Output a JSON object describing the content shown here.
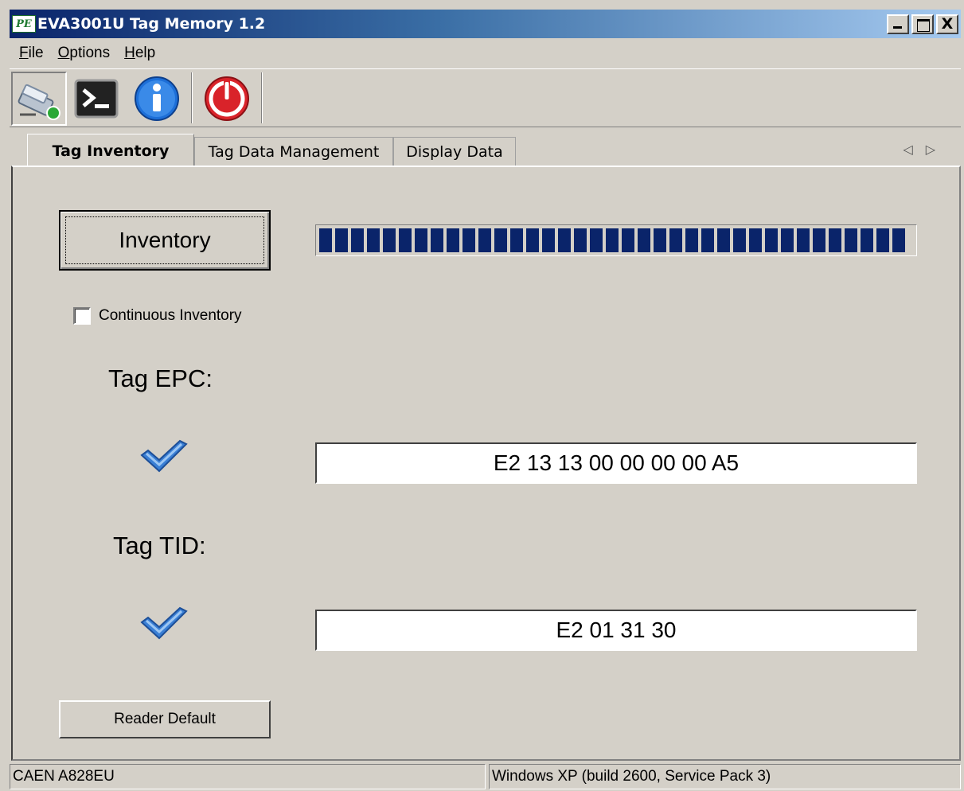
{
  "window": {
    "app_icon": "PE",
    "title": "EVA3001U Tag Memory 1.2",
    "close_glyph": "X"
  },
  "menu": {
    "file": "F",
    "file_rest": "ile",
    "options": "O",
    "options_rest": "ptions",
    "help": "H",
    "help_rest": "elp"
  },
  "toolbar": {
    "icons": [
      "usb-connected-icon",
      "terminal-icon",
      "info-icon",
      "power-icon"
    ]
  },
  "tabs": [
    {
      "label": "Tag Inventory",
      "active": true
    },
    {
      "label": "Tag Data Management",
      "active": false
    },
    {
      "label": "Display Data",
      "active": false
    }
  ],
  "tab_scroll": {
    "left": "◁",
    "right": "▷"
  },
  "inventory": {
    "button_label": "Inventory",
    "progress_fraction": 1.0,
    "continuous_label": "Continuous Inventory",
    "continuous_checked": false
  },
  "epc": {
    "label": "Tag EPC:",
    "value": "E2 13 13 00 00 00 00 A5"
  },
  "tid": {
    "label": "Tag TID:",
    "value": "E2 01 31 30"
  },
  "reader_default_label": "Reader Default",
  "status": {
    "device": "CAEN A828EU",
    "os": "Windows XP (build 2600, Service Pack 3)"
  },
  "colors": {
    "accent": "#0a246a",
    "face": "#d4d0c8",
    "check": "#3a7fd5"
  }
}
